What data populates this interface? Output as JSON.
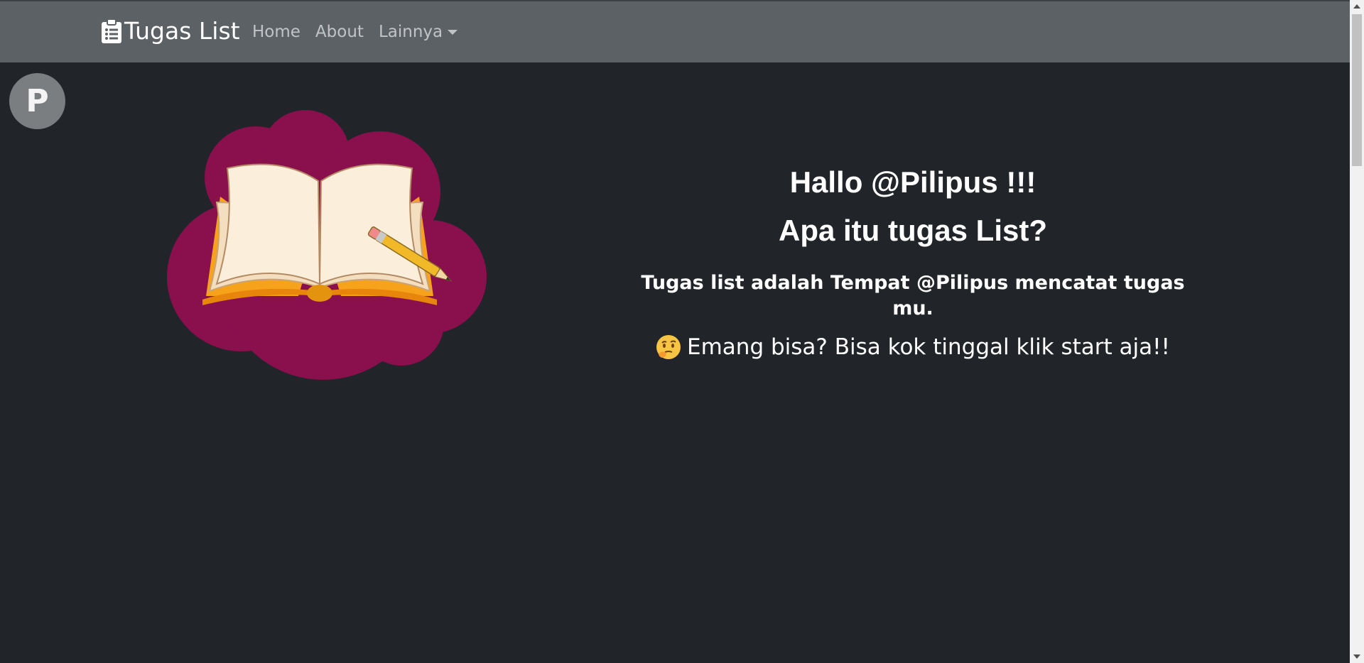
{
  "navbar": {
    "brand_icon": "clipboard-list-icon",
    "brand": "Tugas List",
    "links": [
      "Home",
      "About",
      "Lainnya"
    ],
    "dropdown_icon": "caret-down-icon"
  },
  "avatar": {
    "letter": "P"
  },
  "hero": {
    "illustration": "book-pencil-icon",
    "title1": "Hallo @Pilipus !!!",
    "title2": "Apa itu tugas List?",
    "description": "Tugas list adalah Tempat @Pilipus mencatat tugas mu.",
    "question_emoji": "thinking-face-icon",
    "question": "Emang bisa? Bisa kok tinggal klik start aja!!"
  },
  "colors": {
    "background": "#212529",
    "navbar": "#5c6166",
    "blob": "#8a0f4d",
    "avatar": "#7b7e81"
  }
}
